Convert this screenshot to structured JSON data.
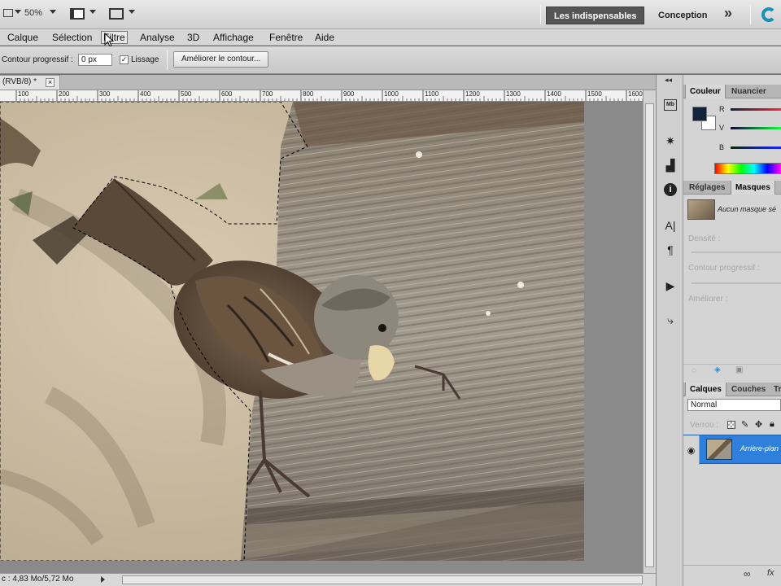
{
  "appbar": {
    "zoom": "50%",
    "workspace_active": "Les indispensables",
    "workspace_other": "Conception",
    "overflow_glyph": "»"
  },
  "menubar": {
    "items": [
      "Calque",
      "Sélection",
      "Filtre",
      "Analyse",
      "3D",
      "Affichage",
      "Fenêtre",
      "Aide"
    ]
  },
  "options": {
    "feather_label": "Contour progressif :",
    "feather_value": "0 px",
    "smoothing_label": "Lissage",
    "refine_edge_button": "Améliorer le contour..."
  },
  "document": {
    "tab_title": "(RVB/8) *",
    "ruler_marks": [
      "100",
      "200",
      "300",
      "400",
      "500",
      "600",
      "700",
      "800",
      "900",
      "1000",
      "1100",
      "1200",
      "1300",
      "1400",
      "1500",
      "1600"
    ],
    "status": "c : 4,83 Mo/5,72 Mo"
  },
  "panels": {
    "color_tabs": [
      "Couleur",
      "Nuancier"
    ],
    "channels": [
      "R",
      "V",
      "B"
    ],
    "adjust_tabs": [
      "Réglages",
      "Masques"
    ],
    "mask_text": "Aucun masque sé",
    "density_label": "Densité :",
    "feather_label": "Contour progressif :",
    "refine_label": "Améliorer :",
    "layer_tabs": [
      "Calques",
      "Couches",
      "Tr"
    ],
    "blend_mode": "Normal",
    "lock_label": "Verrou :",
    "layer_name": "Arrière-plan",
    "fx_label": "fx"
  },
  "colors": {
    "foreground": "#13243c",
    "background": "#ffffff",
    "selection_highlight": "#2f7fdd"
  }
}
